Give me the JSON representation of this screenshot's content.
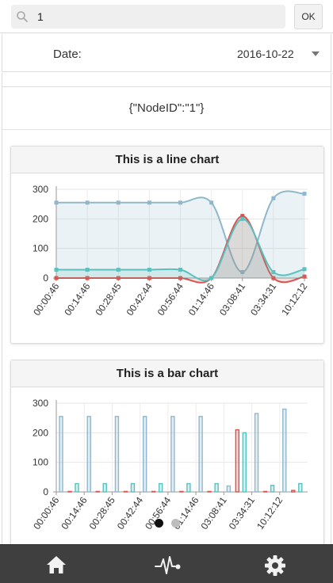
{
  "search": {
    "value": "1"
  },
  "ok_label": "OK",
  "date": {
    "label": "Date:",
    "value": "2016-10-22"
  },
  "node_json": "{\"NodeID\":\"1\"}",
  "line_card": {
    "title": "This is a line chart"
  },
  "bar_card": {
    "title": "This is a bar chart"
  },
  "chart_data": [
    {
      "type": "line",
      "title": "This is a line chart",
      "categories": [
        "00:00:46",
        "00:14:46",
        "00:28:45",
        "00:42:44",
        "00:56:44",
        "01:14:46",
        "03:08:41",
        "03:34:31",
        "10:12:12"
      ],
      "ylim": [
        0,
        300
      ],
      "yticks": [
        0,
        100,
        200,
        300
      ],
      "grid": true,
      "series": [
        {
          "color": "#8fb8cc",
          "values": [
            255,
            255,
            255,
            255,
            255,
            255,
            20,
            270,
            285
          ]
        },
        {
          "color": "#d9534f",
          "values": [
            0,
            0,
            0,
            0,
            0,
            0,
            210,
            0,
            5
          ]
        },
        {
          "color": "#5bc0be",
          "values": [
            28,
            28,
            28,
            28,
            28,
            0,
            200,
            20,
            30
          ]
        }
      ]
    },
    {
      "type": "bar",
      "title": "This is a bar chart",
      "categories": [
        "00:00:46",
        "00:14:46",
        "00:28:45",
        "00:42:44",
        "00:56:44",
        "01:14:46",
        "03:08:41",
        "03:34:31",
        "10:12:12"
      ],
      "ylim": [
        0,
        300
      ],
      "yticks": [
        0,
        100,
        200,
        300
      ],
      "grid": true,
      "series": [
        {
          "color": "#8fb8cc",
          "values": [
            255,
            255,
            255,
            255,
            255,
            255,
            20,
            265,
            280
          ]
        },
        {
          "color": "#d9534f",
          "values": [
            0,
            0,
            0,
            0,
            0,
            0,
            210,
            0,
            5
          ]
        },
        {
          "color": "#5bc0be",
          "values": [
            28,
            28,
            28,
            28,
            28,
            28,
            200,
            22,
            28
          ]
        }
      ]
    }
  ],
  "pager": {
    "active": 0,
    "count": 2
  },
  "tabs": [
    {
      "icon": "home-icon"
    },
    {
      "icon": "pulse-icon"
    },
    {
      "icon": "gear-icon"
    }
  ],
  "colors": {
    "tab_bar": "#3f3f3f",
    "tab_icon": "#f2f2f2"
  }
}
